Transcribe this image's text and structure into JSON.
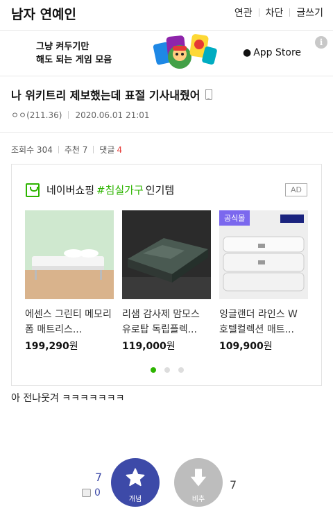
{
  "header": {
    "gallery_title": "남자 연예인",
    "links": [
      "연관",
      "차단",
      "글쓰기"
    ]
  },
  "ad_banner": {
    "line1": "그냥 켜두기만",
    "line2": "해도 되는 게임 모음",
    "store_label": "App Store",
    "info_label": "i"
  },
  "post": {
    "title": "나 위키트리 제보했는데 표절 기사내줬어",
    "author": "ㅇㅇ(211.36)",
    "date": "2020.06.01 21:01"
  },
  "stats": {
    "views_label": "조회수 304",
    "recommend_label": "추천 7",
    "comments_label": "댓글",
    "comments_count": "4"
  },
  "shopping": {
    "brand": "네이버쇼핑",
    "hashtag": "#침실가구",
    "suffix": "인기템",
    "ad_badge": "AD",
    "products": [
      {
        "name": "에센스 그린티 메모리폼 매트리스...",
        "price": "199,290",
        "unit": "원",
        "badge": ""
      },
      {
        "name": "리샘 감사제 맘모스 유로탑 독립플렉...",
        "price": "119,000",
        "unit": "원",
        "badge": ""
      },
      {
        "name": "잉글랜더 라인스 W 호텔컬렉션 매트...",
        "price": "109,900",
        "unit": "원",
        "badge": "공식몰"
      }
    ],
    "active_page": 1,
    "total_pages": 3
  },
  "body_text": "아 전나웃겨 ㅋㅋㅋㅋㅋㅋㅋ",
  "votes": {
    "up_count": "7",
    "up_sub_count": "0",
    "up_label": "개념",
    "down_count": "7",
    "down_label": "비추"
  },
  "colors": {
    "naver_green": "#2db400",
    "vote_blue": "#3d4aa8",
    "comment_red": "#e53935"
  }
}
